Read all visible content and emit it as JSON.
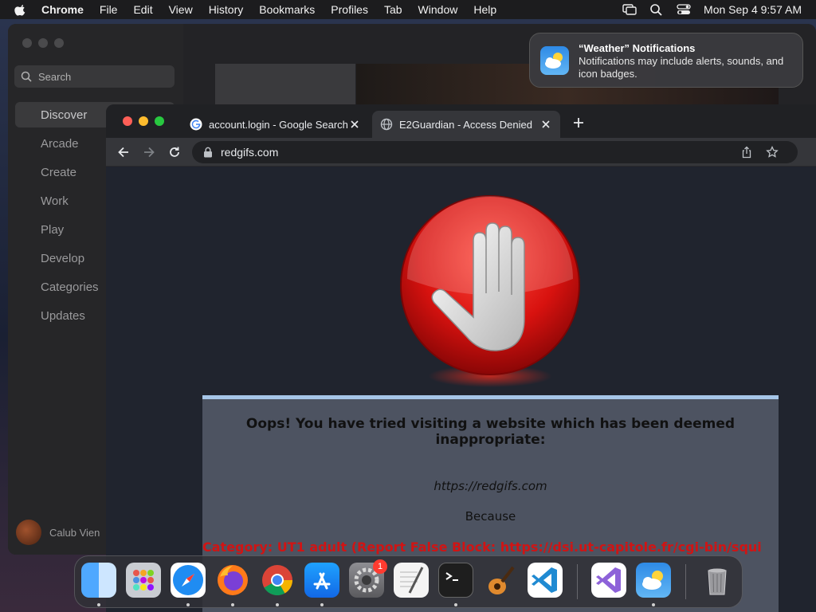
{
  "menubar": {
    "app_name": "Chrome",
    "items": [
      "File",
      "Edit",
      "View",
      "History",
      "Bookmarks",
      "Profiles",
      "Tab",
      "Window",
      "Help"
    ],
    "clock": "Mon Sep 4  9:57 AM"
  },
  "appstore": {
    "search_placeholder": "Search",
    "nav": [
      "Discover",
      "Arcade",
      "Create",
      "Work",
      "Play",
      "Develop",
      "Categories",
      "Updates"
    ],
    "active_nav": "Discover",
    "user_name": "Calub Vien"
  },
  "notification": {
    "title": "“Weather” Notifications",
    "body": "Notifications may include alerts, sounds, and icon badges."
  },
  "browser": {
    "tabs": [
      {
        "title": "account.login - Google Search",
        "favicon": "google-icon"
      },
      {
        "title": "E2Guardian - Access Denied",
        "favicon": "globe-icon"
      }
    ],
    "active_tab": 1,
    "address": "redgifs.com"
  },
  "page": {
    "headline": "Oops! You have tried visiting a website which has been deemed inappropriate:",
    "blocked_url": "https://redgifs.com",
    "because": "Because",
    "category_line": "Category: UT1 adult (Report False Block: https://dsi.ut-capitole.fr/cgi-bin/squi"
  },
  "dock": {
    "apps": [
      "finder-icon",
      "launchpad-icon",
      "safari-icon",
      "firefox-icon",
      "chrome-icon",
      "app-store-icon",
      "system-settings-icon",
      "textedit-icon",
      "terminal-icon",
      "garageband-icon",
      "vscode-icon",
      "visual-studio-icon",
      "weather-icon",
      "trash-icon"
    ],
    "settings_badge": "1"
  },
  "colors": {
    "category_red": "#d01414",
    "panel_border": "#a6c6e8",
    "panel_bg": "#4d5361"
  }
}
